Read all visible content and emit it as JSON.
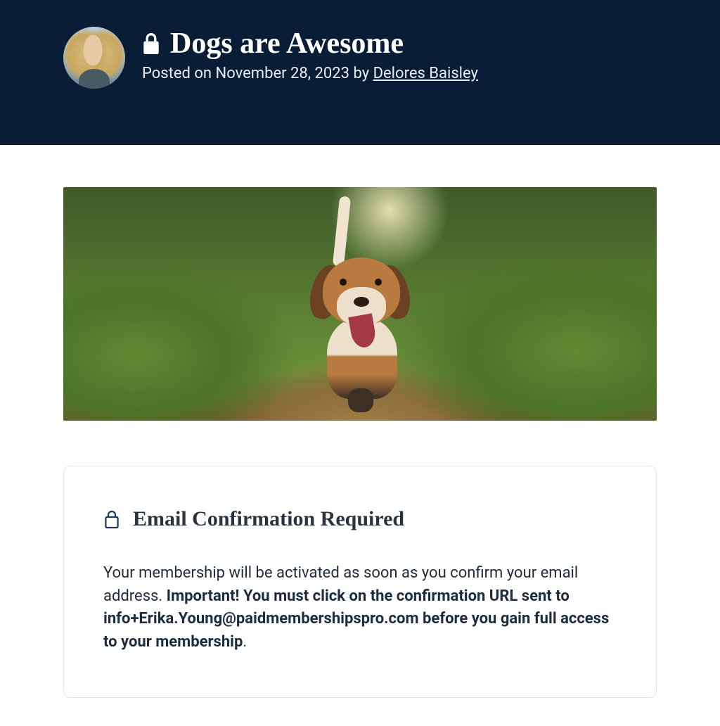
{
  "header": {
    "title": "Dogs are Awesome",
    "meta_prefix": "Posted on ",
    "date": "November 28, 2023",
    "by": " by ",
    "author": "Delores Baisley"
  },
  "card": {
    "title": "Email Confirmation Required",
    "body_1": "Your membership will be activated as soon as you confirm your email address. ",
    "body_bold": "Important! You must click on the confirmation URL sent to info+Erika.Young@paidmembershipspro.com before you gain full access to your membership",
    "body_period": "."
  }
}
